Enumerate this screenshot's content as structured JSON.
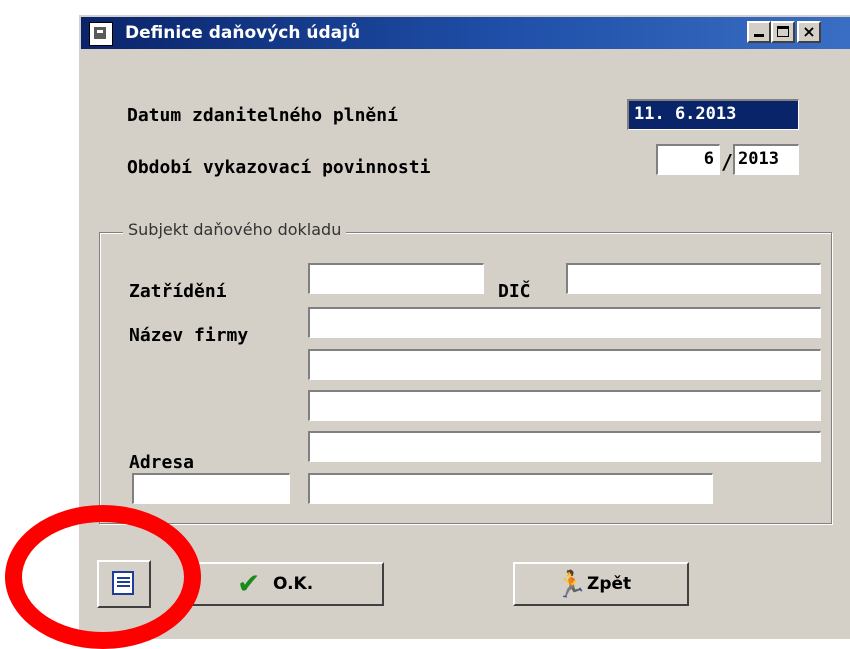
{
  "window": {
    "title": "Definice daňových údajů",
    "controls": {
      "minimize": "_",
      "maximize": "□",
      "close": "×"
    }
  },
  "form": {
    "datum_label": "Datum zdanitelného plnění",
    "datum_value": "11. 6.2013",
    "obdobi_label": "Období vykazovací povinnosti",
    "obdobi_month": "6",
    "obdobi_separator": "/",
    "obdobi_year": "2013"
  },
  "group": {
    "caption": "Subjekt daňového dokladu",
    "zatrideni_label": "Zatřídění",
    "zatrideni_value": "",
    "dic_label": "DIČ",
    "dic_value": "",
    "nazev_label": "Název firmy",
    "nazev_line1": "",
    "nazev_line2": "",
    "nazev_line3": "",
    "adresa_label": "Adresa",
    "adresa_line1": "",
    "psc_value": "",
    "obec_value": ""
  },
  "buttons": {
    "ok_label": "O.K.",
    "back_label": "Zpět"
  },
  "icons": {
    "title": "app-icon",
    "doc": "document-icon",
    "ok": "check-icon",
    "back": "running-man-icon"
  },
  "colors": {
    "titlebar": "#0a246a",
    "face": "#d4d0c8",
    "annotation": "#ff0000"
  }
}
